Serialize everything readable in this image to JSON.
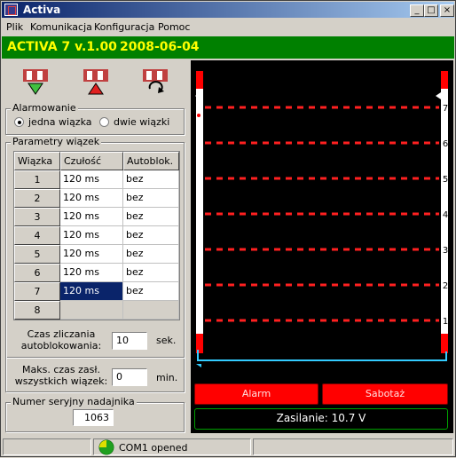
{
  "window": {
    "title": "Activa",
    "minimize": "_",
    "maximize": "□",
    "close": "×"
  },
  "menu": [
    "Plik",
    "Komunikacja",
    "Konfiguracja",
    "Pomoc"
  ],
  "header": {
    "version": "ACTIVA 7 v.1.00",
    "date": "2008-06-04"
  },
  "toolbar": {
    "icons": [
      "tool-down-icon",
      "tool-up-icon",
      "tool-refresh-icon"
    ]
  },
  "alarm": {
    "title": "Alarmowanie",
    "option1": "jedna wiązka",
    "option2": "dwie wiązki",
    "selected": "jedna wiązka"
  },
  "beams": {
    "title": "Parametry wiązek",
    "headers": [
      "Wiązka",
      "Czułość",
      "Autoblok."
    ],
    "rows": [
      {
        "id": "1",
        "sens": "120 ms",
        "auto": "bez"
      },
      {
        "id": "2",
        "sens": "120 ms",
        "auto": "bez"
      },
      {
        "id": "3",
        "sens": "120 ms",
        "auto": "bez"
      },
      {
        "id": "4",
        "sens": "120 ms",
        "auto": "bez"
      },
      {
        "id": "5",
        "sens": "120 ms",
        "auto": "bez"
      },
      {
        "id": "6",
        "sens": "120 ms",
        "auto": "bez"
      },
      {
        "id": "7",
        "sens": "120 ms",
        "auto": "bez"
      },
      {
        "id": "8",
        "sens": "",
        "auto": ""
      }
    ],
    "selected_row": "7"
  },
  "count_time": {
    "label1": "Czas zliczania",
    "label2": "autoblokowania:",
    "value": "10",
    "unit": "sek."
  },
  "max_time": {
    "label1": "Maks. czas zasł.",
    "label2": "wszystkich wiązek:",
    "value": "0",
    "unit": "min."
  },
  "serial": {
    "title": "Numer seryjny nadajnika",
    "value": "1063"
  },
  "display": {
    "beam_labels": [
      "7",
      "6",
      "5",
      "4",
      "3",
      "2",
      "1"
    ],
    "alarm_button": "Alarm",
    "sabotage_button": "Sabotaż",
    "power": "Zasilanie: 10.7 V",
    "colors": {
      "beam": "#ff2020",
      "frame": "#33ccff",
      "power_border": "#00a000"
    }
  },
  "status": {
    "port": "COM1 opened"
  }
}
